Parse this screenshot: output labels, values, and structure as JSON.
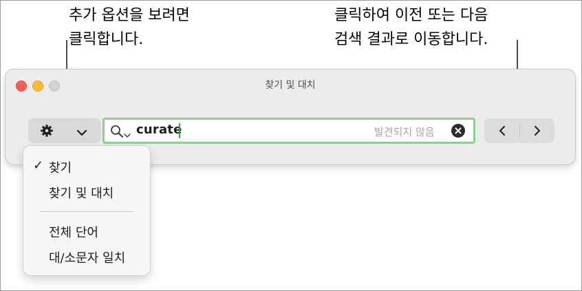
{
  "callouts": {
    "left": "추가 옵션을 보려면\n클릭합니다.",
    "right": "클릭하여 이전 또는 다음\n검색 결과로 이동합니다."
  },
  "window": {
    "title": "찾기 및 대치"
  },
  "toolbar": {
    "options_icon": "gear-icon",
    "options_menu_icon": "chevron-down-icon",
    "prev_icon": "chevron-left-icon",
    "next_icon": "chevron-right-icon"
  },
  "search": {
    "value": "curate",
    "status": "발견되지 않음",
    "focus_color": "#8fd08e"
  },
  "menu": {
    "items": [
      {
        "label": "찾기",
        "checked": true,
        "check": "✓"
      },
      {
        "label": "찾기 및 대치",
        "checked": false
      },
      {
        "label": "전체 단어",
        "checked": false
      },
      {
        "label": "대/소문자 일치",
        "checked": false
      }
    ]
  },
  "colors": {
    "close": "#ff5f57",
    "minimize": "#febc2e",
    "zoom": "#d3d3d3"
  }
}
